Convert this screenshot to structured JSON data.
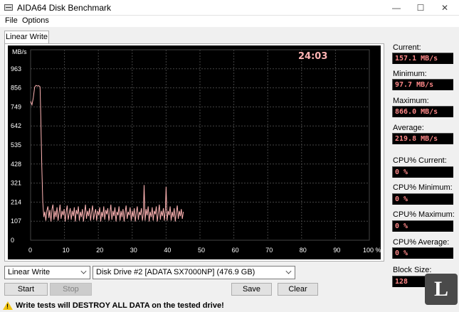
{
  "window": {
    "title": "AIDA64 Disk Benchmark",
    "minimize_glyph": "—",
    "maximize_glyph": "☐",
    "close_glyph": "✕"
  },
  "menu": {
    "file": "File",
    "options": "Options"
  },
  "tab": {
    "label": "Linear Write"
  },
  "chart_data": {
    "type": "line",
    "ylabel": "MB/s",
    "timer": "24:03",
    "y_ticks": [
      "963",
      "856",
      "749",
      "642",
      "535",
      "428",
      "321",
      "214",
      "107",
      "0"
    ],
    "y_tick_values": [
      963,
      856,
      749,
      642,
      535,
      428,
      321,
      214,
      107,
      0
    ],
    "x_ticks": [
      "0",
      "10",
      "20",
      "30",
      "40",
      "50",
      "60",
      "70",
      "80",
      "90",
      "100 %"
    ],
    "x_tick_values": [
      0,
      10,
      20,
      30,
      40,
      50,
      60,
      70,
      80,
      90,
      100
    ],
    "xlim": [
      0,
      100
    ],
    "ylim": [
      0,
      1070
    ],
    "grid": true,
    "colors": {
      "background": "#000000",
      "grid": "#444444",
      "line": "#ffb4b4",
      "text": "#ffffff",
      "timer": "#ffb4b4"
    },
    "series": [
      {
        "values": [
          [
            0.0,
            780
          ],
          [
            0.4,
            760
          ],
          [
            0.8,
            800
          ],
          [
            1.2,
            860
          ],
          [
            1.6,
            870
          ],
          [
            2.0,
            866
          ],
          [
            2.4,
            868
          ],
          [
            2.8,
            862
          ],
          [
            3.0,
            700
          ],
          [
            3.3,
            420
          ],
          [
            3.6,
            215
          ],
          [
            3.9,
            130
          ],
          [
            4.2,
            160
          ],
          [
            4.5,
            110
          ],
          [
            4.8,
            165
          ],
          [
            5.1,
            190
          ],
          [
            5.4,
            125
          ],
          [
            5.7,
            170
          ],
          [
            6.0,
            105
          ],
          [
            6.3,
            175
          ],
          [
            6.6,
            200
          ],
          [
            6.9,
            115
          ],
          [
            7.2,
            165
          ],
          [
            7.5,
            130
          ],
          [
            7.8,
            185
          ],
          [
            8.1,
            110
          ],
          [
            8.4,
            155
          ],
          [
            8.7,
            200
          ],
          [
            9.0,
            120
          ],
          [
            9.3,
            165
          ],
          [
            9.6,
            140
          ],
          [
            9.9,
            175
          ],
          [
            10.2,
            105
          ],
          [
            10.5,
            160
          ],
          [
            10.8,
            195
          ],
          [
            11.1,
            115
          ],
          [
            11.4,
            150
          ],
          [
            11.7,
            180
          ],
          [
            12.0,
            115
          ],
          [
            12.3,
            165
          ],
          [
            12.6,
            135
          ],
          [
            12.9,
            185
          ],
          [
            13.2,
            105
          ],
          [
            13.5,
            170
          ],
          [
            13.8,
            145
          ],
          [
            14.1,
            190
          ],
          [
            14.4,
            110
          ],
          [
            14.7,
            160
          ],
          [
            15.0,
            130
          ],
          [
            15.3,
            175
          ],
          [
            15.6,
            105
          ],
          [
            15.9,
            155
          ],
          [
            16.2,
            200
          ],
          [
            16.5,
            120
          ],
          [
            16.8,
            165
          ],
          [
            17.1,
            135
          ],
          [
            17.4,
            180
          ],
          [
            17.7,
            110
          ],
          [
            18.0,
            160
          ],
          [
            18.3,
            195
          ],
          [
            18.6,
            115
          ],
          [
            18.9,
            150
          ],
          [
            19.2,
            175
          ],
          [
            19.5,
            110
          ],
          [
            19.8,
            165
          ],
          [
            20.1,
            140
          ],
          [
            20.4,
            185
          ],
          [
            20.7,
            105
          ],
          [
            21.0,
            160
          ],
          [
            21.3,
            130
          ],
          [
            21.6,
            190
          ],
          [
            21.9,
            115
          ],
          [
            22.2,
            170
          ],
          [
            22.5,
            145
          ],
          [
            22.8,
            180
          ],
          [
            23.1,
            110
          ],
          [
            23.4,
            155
          ],
          [
            23.7,
            200
          ],
          [
            24.0,
            115
          ],
          [
            24.3,
            165
          ],
          [
            24.6,
            135
          ],
          [
            24.9,
            185
          ],
          [
            25.2,
            105
          ],
          [
            25.5,
            160
          ],
          [
            25.8,
            140
          ],
          [
            26.1,
            190
          ],
          [
            26.4,
            110
          ],
          [
            26.7,
            165
          ],
          [
            27.0,
            130
          ],
          [
            27.3,
            175
          ],
          [
            27.6,
            105
          ],
          [
            27.9,
            155
          ],
          [
            28.2,
            195
          ],
          [
            28.5,
            120
          ],
          [
            28.8,
            160
          ],
          [
            29.1,
            140
          ],
          [
            29.4,
            185
          ],
          [
            29.7,
            110
          ],
          [
            30.0,
            165
          ],
          [
            30.3,
            130
          ],
          [
            30.6,
            180
          ],
          [
            30.9,
            105
          ],
          [
            31.2,
            155
          ],
          [
            31.5,
            190
          ],
          [
            31.8,
            115
          ],
          [
            32.1,
            160
          ],
          [
            32.4,
            140
          ],
          [
            32.7,
            180
          ],
          [
            33.0,
            110
          ],
          [
            33.3,
            150
          ],
          [
            33.5,
            310
          ],
          [
            33.8,
            110
          ],
          [
            34.1,
            175
          ],
          [
            34.4,
            140
          ],
          [
            34.7,
            190
          ],
          [
            35.0,
            105
          ],
          [
            35.3,
            160
          ],
          [
            35.6,
            130
          ],
          [
            35.9,
            185
          ],
          [
            36.2,
            110
          ],
          [
            36.5,
            165
          ],
          [
            36.8,
            145
          ],
          [
            37.1,
            190
          ],
          [
            37.4,
            105
          ],
          [
            37.7,
            155
          ],
          [
            38.0,
            200
          ],
          [
            38.3,
            115
          ],
          [
            38.6,
            165
          ],
          [
            38.9,
            135
          ],
          [
            39.2,
            180
          ],
          [
            39.5,
            110
          ],
          [
            39.8,
            170
          ],
          [
            40.0,
            300
          ],
          [
            40.3,
            110
          ],
          [
            40.6,
            165
          ],
          [
            40.9,
            140
          ],
          [
            41.2,
            190
          ],
          [
            41.5,
            110
          ],
          [
            41.8,
            160
          ],
          [
            42.1,
            130
          ],
          [
            42.4,
            180
          ],
          [
            42.7,
            105
          ],
          [
            43.0,
            155
          ],
          [
            43.3,
            195
          ],
          [
            43.6,
            120
          ],
          [
            43.9,
            165
          ],
          [
            44.2,
            135
          ],
          [
            44.5,
            175
          ],
          [
            44.8,
            120
          ],
          [
            45.1,
            160
          ]
        ]
      }
    ]
  },
  "stats": {
    "current_label": "Current:",
    "current_value": "157.1 MB/s",
    "minimum_label": "Minimum:",
    "minimum_value": "97.7 MB/s",
    "maximum_label": "Maximum:",
    "maximum_value": "866.0 MB/s",
    "average_label": "Average:",
    "average_value": "219.8 MB/s",
    "cpu_current_label": "CPU% Current:",
    "cpu_current_value": "0 %",
    "cpu_minimum_label": "CPU% Minimum:",
    "cpu_minimum_value": "0 %",
    "cpu_maximum_label": "CPU% Maximum:",
    "cpu_maximum_value": "0 %",
    "cpu_average_label": "CPU% Average:",
    "cpu_average_value": "0 %",
    "block_size_label": "Block Size:",
    "block_size_value": "128"
  },
  "controls": {
    "test_select": "Linear Write",
    "drive_select": "Disk Drive #2  [ADATA SX7000NP]  (476.9 GB)",
    "start_label": "Start",
    "stop_label": "Stop",
    "save_label": "Save",
    "clear_label": "Clear"
  },
  "warning": {
    "icon_glyph": "!",
    "text": "Write tests will DESTROY ALL DATA on the tested drive!"
  },
  "watermark": {
    "text": "L"
  }
}
